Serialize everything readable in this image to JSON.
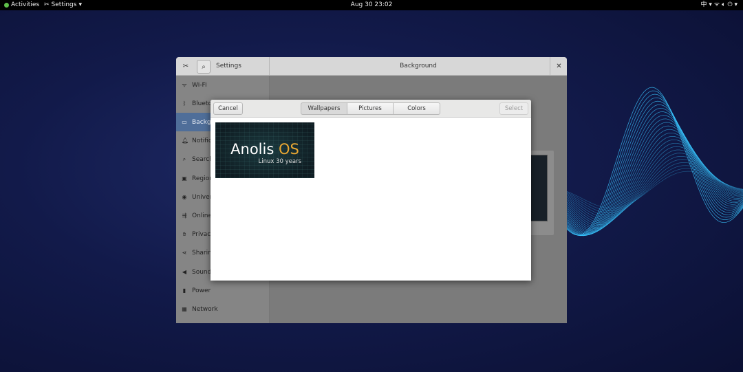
{
  "topbar": {
    "activities": "Activities",
    "app_menu": "Settings",
    "clock": "Aug 30  23:02",
    "input_method": "中",
    "icons": [
      "network-wireless-icon",
      "volume-icon",
      "power-icon"
    ]
  },
  "settings": {
    "title": "Settings",
    "panel_title": "Background",
    "sidebar": [
      {
        "label": "Wi-Fi",
        "icon": "wifi-icon"
      },
      {
        "label": "Bluetoo",
        "icon": "bluetooth-icon"
      },
      {
        "label": "Backgr",
        "icon": "background-icon",
        "active": true
      },
      {
        "label": "Notifica",
        "icon": "bell-icon"
      },
      {
        "label": "Search",
        "icon": "search-icon"
      },
      {
        "label": "Region",
        "icon": "region-icon"
      },
      {
        "label": "Univers",
        "icon": "universal-access-icon"
      },
      {
        "label": "Online A",
        "icon": "online-accounts-icon"
      },
      {
        "label": "Privacy",
        "icon": "privacy-icon"
      },
      {
        "label": "Sharing",
        "icon": "sharing-icon"
      },
      {
        "label": "Sound",
        "icon": "sound-icon"
      },
      {
        "label": "Power",
        "icon": "power-icon"
      },
      {
        "label": "Network",
        "icon": "network-icon"
      }
    ]
  },
  "dialog": {
    "cancel": "Cancel",
    "select": "Select",
    "tabs": [
      "Wallpapers",
      "Pictures",
      "Colors"
    ],
    "selected_tab": "Wallpapers",
    "wallpaper": {
      "title_main": "Anolis ",
      "title_accent": "OS",
      "subtitle": "Linux 30 years"
    }
  },
  "colors": {
    "accent_sidebar": "#4f6e99",
    "wallpaper_accent": "#e8a632",
    "wave": "#39c6ff"
  }
}
